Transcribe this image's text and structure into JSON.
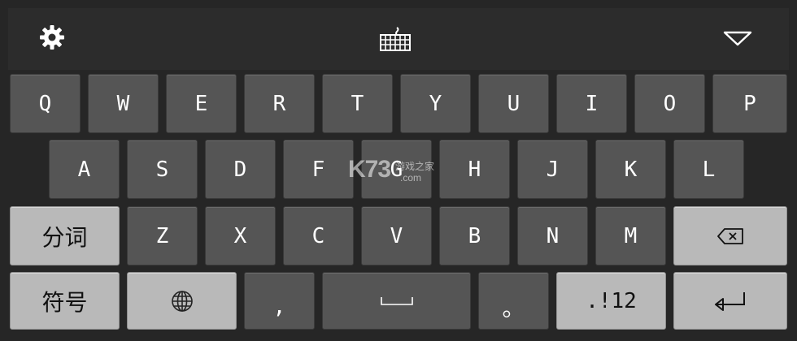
{
  "toolbar": {
    "settings_icon": "gear-icon",
    "keyboard_icon": "keyboard-icon",
    "collapse_icon": "triangle-down-icon"
  },
  "rows": {
    "row1": [
      "Q",
      "W",
      "E",
      "R",
      "T",
      "Y",
      "U",
      "I",
      "O",
      "P"
    ],
    "row2": [
      "A",
      "S",
      "D",
      "F",
      "G",
      "H",
      "J",
      "K",
      "L"
    ],
    "row3": [
      "Z",
      "X",
      "C",
      "V",
      "B",
      "N",
      "M"
    ]
  },
  "keys": {
    "segment": "分词",
    "symbols": "符号",
    "comma": ",",
    "period": "。",
    "numbers": ".!12"
  },
  "watermark": {
    "logo": "K73",
    "cn": "游戏之家",
    "com": ".com"
  },
  "colors": {
    "background": "#262626",
    "key_dark": "#555555",
    "key_light": "#b9b9b9"
  }
}
